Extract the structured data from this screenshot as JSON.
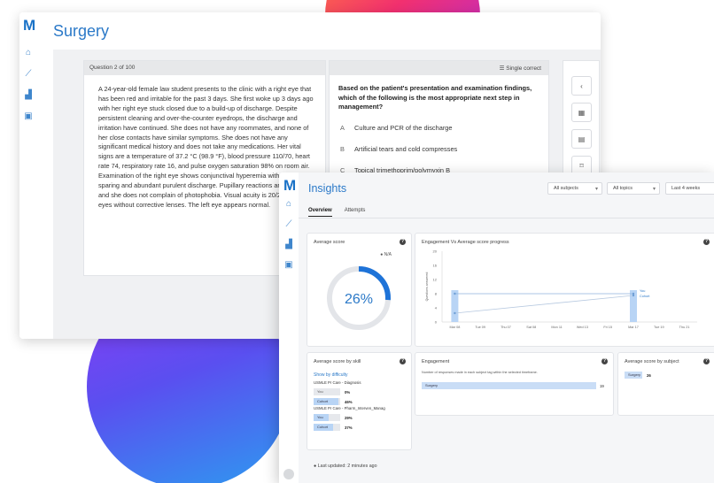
{
  "surgery": {
    "title": "Surgery",
    "question_counter": "Question 2 of 100",
    "question_text": "A 24-year-old female law student presents to the clinic with a right eye that has been red and irritable for the past 3 days. She first woke up 3 days ago with her right eye stuck closed due to a build-up of discharge. Despite persistent cleaning and over-the-counter eyedrops, the discharge and irritation have continued. She does not have any roommates, and none of her close contacts have similar symptoms. She does not have any significant medical history and does not take any medications. Her vital signs are a temperature of 37.2 °C (98.9 °F), blood pressure 110/70, heart rate 74, respiratory rate 16, and pulse oxygen saturation 98% on room air. Examination of the right eye shows conjunctival hyperemia with perilimbal sparing and abundant purulent discharge. Pupillary reactions are normal, and she does not complain of photophobia. Visual acuity is 20/20 in both eyes without corrective lenses. The left eye appears normal.",
    "answer_mode": "Single correct",
    "answer_question": "Based on the patient's presentation and examination findings, which of the following is the most appropriate next step in management?",
    "options": [
      {
        "letter": "A",
        "text": "Culture and PCR of the discharge"
      },
      {
        "letter": "B",
        "text": "Artificial tears and cold compresses"
      },
      {
        "letter": "C",
        "text": "Topical trimethoprim/polymyxin B"
      }
    ]
  },
  "insights": {
    "title": "Insights",
    "filters": [
      "All subjects",
      "All topics",
      "Last 4 weeks"
    ],
    "tabs": [
      "Overview",
      "Attempts"
    ],
    "average_score": {
      "title": "Average score",
      "legend": "N/A",
      "value": "26%",
      "fraction": 0.26
    },
    "progress_title": "Engagement Vs Average score progress",
    "skill": {
      "title": "Average score by skill",
      "link": "Show by difficulty",
      "groups": [
        {
          "name": "USMLE Pr Care - Diagnosis",
          "you_label": "You",
          "you": "0%",
          "cohort_label": "Cohort",
          "cohort": "46%",
          "you_frac": 0.0,
          "cohort_frac": 0.46
        },
        {
          "name": "USMLE Pr Care - Pharm_Interven_Manag",
          "you_label": "You",
          "you": "29%",
          "cohort_label": "Cohort",
          "cohort": "37%",
          "you_frac": 0.29,
          "cohort_frac": 0.37
        }
      ]
    },
    "engagement": {
      "title": "Engagement",
      "subtitle": "Number of responses made in each subject tag within the selected timeframe.",
      "rows": [
        {
          "label": "Surgery",
          "value": "19"
        }
      ]
    },
    "by_subject": {
      "title": "Average score by subject",
      "rows": [
        {
          "label": "Surgery",
          "value": "26"
        }
      ]
    },
    "last_updated": "Last updated: 2 minutes ago"
  },
  "chart_data": {
    "type": "line",
    "title": "Engagement Vs Average score progress",
    "ylabel": "Questions answered",
    "categories": [
      "Mar 08",
      "Tue 09",
      "Thu 07",
      "Sat 08",
      "Mon 11",
      "Wed 13",
      "Fri 15",
      "Mar 17",
      "Tue 19",
      "Thu 21"
    ],
    "yticks": [
      0,
      4,
      8,
      12,
      16,
      20
    ],
    "ylim": [
      0,
      20
    ],
    "series": [
      {
        "name": "",
        "kind": "bar",
        "values": [
          9,
          0,
          0,
          0,
          0,
          0,
          0,
          9,
          0,
          0
        ]
      },
      {
        "name": "You",
        "kind": "line",
        "points": [
          {
            "x": "Mar 08",
            "y": 8
          },
          {
            "x": "Mar 17",
            "y": 8
          }
        ]
      },
      {
        "name": "Cohort",
        "kind": "line",
        "points": [
          {
            "x": "Mar 08",
            "y": 2.5
          },
          {
            "x": "Mar 17",
            "y": 7.5
          }
        ]
      }
    ],
    "legend_position": "right"
  },
  "colors": {
    "brand": "#2b79c8",
    "bar": "#b8d4f5",
    "gauge": "#1e73d8",
    "gauge_track": "#e3e5e9"
  }
}
